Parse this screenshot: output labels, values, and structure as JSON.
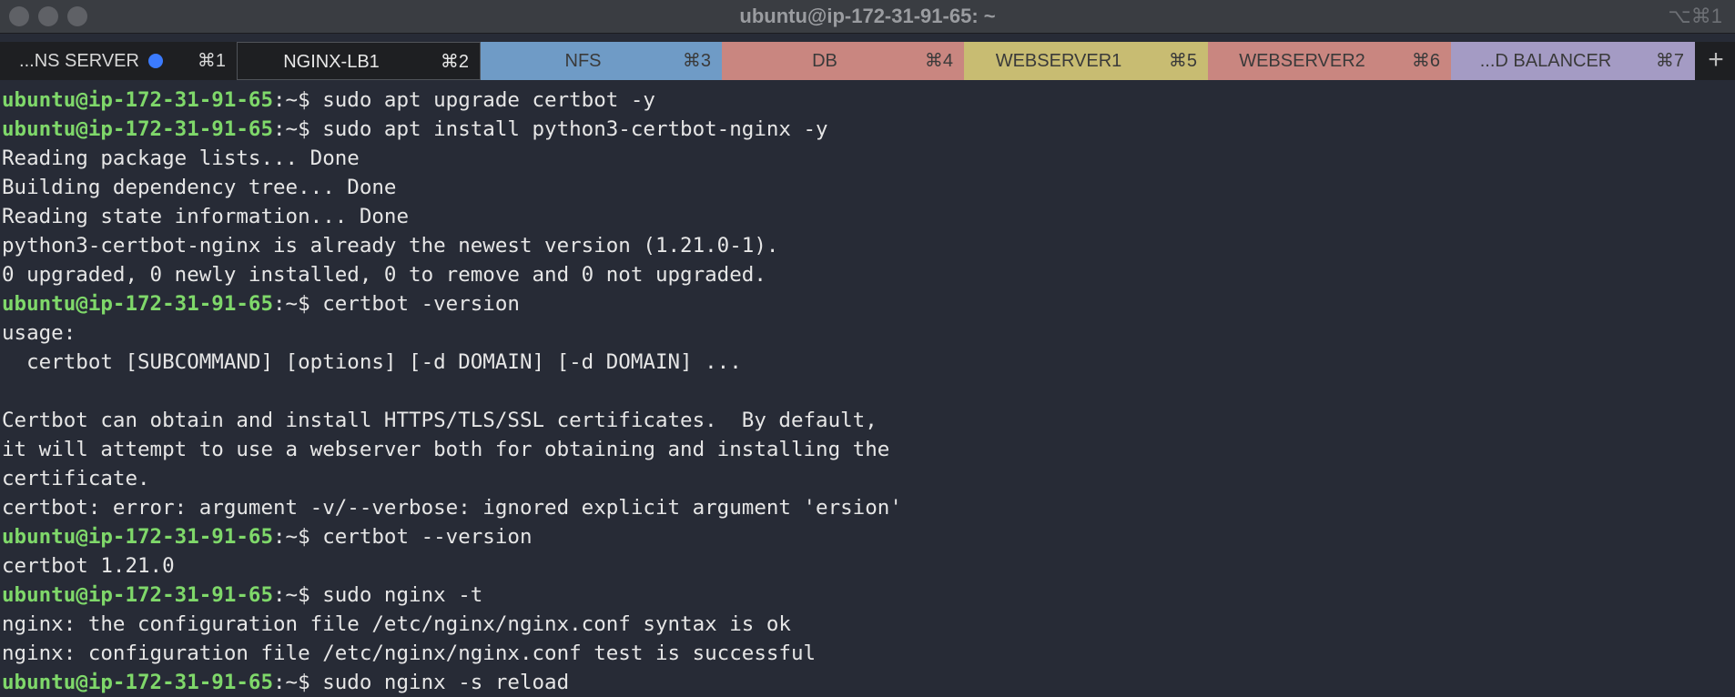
{
  "window": {
    "title": "ubuntu@ip-172-31-91-65: ~",
    "title_shortcut": "⌥⌘1"
  },
  "tabs": [
    {
      "label": "...NS SERVER",
      "shortcut": "⌘1",
      "color": "#1e1f22",
      "has_activity_dot": true,
      "active": false
    },
    {
      "label": "NGINX-LB1",
      "shortcut": "⌘2",
      "color": "#1e1f22",
      "active": true
    },
    {
      "label": "NFS",
      "shortcut": "⌘3",
      "color": "#6f9bc6",
      "active": false
    },
    {
      "label": "DB",
      "shortcut": "⌘4",
      "color": "#c98680",
      "active": false
    },
    {
      "label": "WEBSERVER1",
      "shortcut": "⌘5",
      "color": "#c8bc72",
      "active": false
    },
    {
      "label": "WEBSERVER2",
      "shortcut": "⌘6",
      "color": "#c98680",
      "active": false
    },
    {
      "label": "...D BALANCER",
      "shortcut": "⌘7",
      "color": "#a49bc4",
      "active": false
    }
  ],
  "new_tab_label": "+",
  "terminal": {
    "prompt_user": "ubuntu@ip-172-31-91-65",
    "prompt_path": ":~$ ",
    "lines": [
      {
        "type": "prompt",
        "text": "sudo apt upgrade certbot -y"
      },
      {
        "type": "prompt",
        "text": "sudo apt install python3-certbot-nginx -y"
      },
      {
        "type": "output",
        "text": "Reading package lists... Done"
      },
      {
        "type": "output",
        "text": "Building dependency tree... Done"
      },
      {
        "type": "output",
        "text": "Reading state information... Done"
      },
      {
        "type": "output",
        "text": "python3-certbot-nginx is already the newest version (1.21.0-1)."
      },
      {
        "type": "output",
        "text": "0 upgraded, 0 newly installed, 0 to remove and 0 not upgraded."
      },
      {
        "type": "prompt",
        "text": "certbot -version"
      },
      {
        "type": "output",
        "text": "usage:"
      },
      {
        "type": "output",
        "text": "  certbot [SUBCOMMAND] [options] [-d DOMAIN] [-d DOMAIN] ..."
      },
      {
        "type": "output",
        "text": ""
      },
      {
        "type": "output",
        "text": "Certbot can obtain and install HTTPS/TLS/SSL certificates.  By default,"
      },
      {
        "type": "output",
        "text": "it will attempt to use a webserver both for obtaining and installing the"
      },
      {
        "type": "output",
        "text": "certificate."
      },
      {
        "type": "output",
        "text": "certbot: error: argument -v/--verbose: ignored explicit argument 'ersion'"
      },
      {
        "type": "prompt",
        "text": "certbot --version"
      },
      {
        "type": "output",
        "text": "certbot 1.21.0"
      },
      {
        "type": "prompt",
        "text": "sudo nginx -t"
      },
      {
        "type": "output",
        "text": "nginx: the configuration file /etc/nginx/nginx.conf syntax is ok"
      },
      {
        "type": "output",
        "text": "nginx: configuration file /etc/nginx/nginx.conf test is successful"
      },
      {
        "type": "prompt",
        "text": "sudo nginx -s reload"
      }
    ]
  }
}
